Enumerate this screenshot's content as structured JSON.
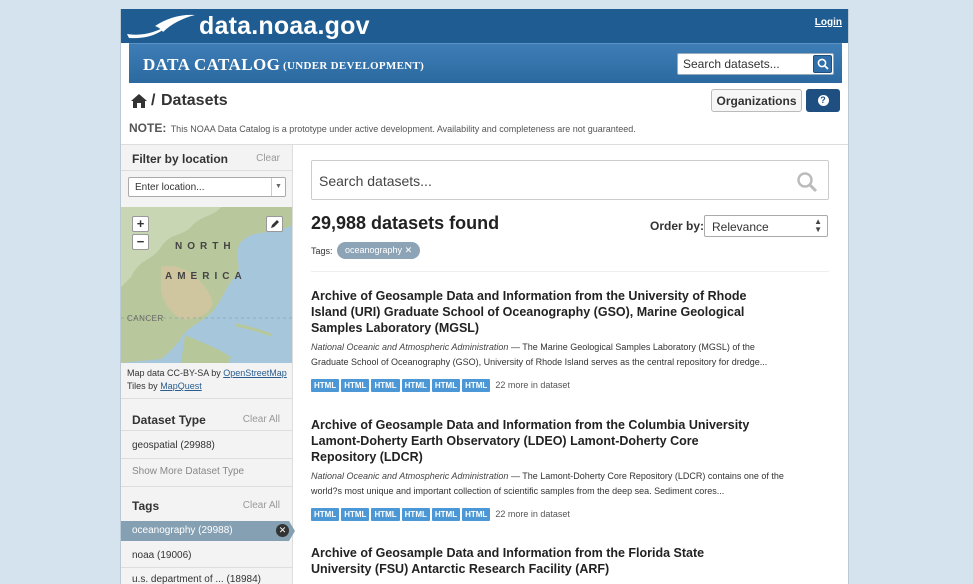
{
  "header": {
    "logo_text": "data.noaa.gov",
    "login_label": "Login",
    "catalog_title": "DATA CATALOG",
    "catalog_subtitle": "(UNDER DEVELOPMENT)",
    "search_placeholder": "Search datasets..."
  },
  "breadcrumb": {
    "separator": "/",
    "current": "Datasets"
  },
  "buttons": {
    "organizations": "Organizations",
    "help_icon": "?"
  },
  "note": {
    "label": "NOTE:",
    "text": "This NOAA Data Catalog is a prototype under active development. Availability and completeness are not guaranteed."
  },
  "sidebar": {
    "location": {
      "title": "Filter by location",
      "clear": "Clear",
      "placeholder": "Enter location...",
      "map_labels": [
        "NORTH",
        "AMERICA",
        "CANCER"
      ],
      "attribution_line1_prefix": "Map data CC-BY-SA by ",
      "attribution_line1_link": "OpenStreetMap",
      "attribution_line2_prefix": "Tiles by ",
      "attribution_line2_link": "MapQuest"
    },
    "dataset_type": {
      "title": "Dataset Type",
      "clear": "Clear All",
      "items": [
        "geospatial (29988)"
      ],
      "show_more": "Show More Dataset Type"
    },
    "tags": {
      "title": "Tags",
      "clear": "Clear All",
      "active": "oceanography (29988)",
      "items": [
        "noaa (19006)",
        "u.s. department of ... (18984)"
      ]
    }
  },
  "main": {
    "search_placeholder": "Search datasets...",
    "count": "29,988 datasets found",
    "order_label": "Order by:",
    "order_value": "Relevance",
    "tags_label": "Tags:",
    "active_tag": "oceanography",
    "results": [
      {
        "title": "Archive of Geosample Data and Information from the University of Rhode Island (URI) Graduate School of Oceanography (GSO), Marine Geological Samples Laboratory (MGSL)",
        "publisher": "National Oceanic and Atmospheric Administration",
        "description": " — The Marine Geological Samples Laboratory (MGSL) of the Graduate School of Oceanography (GSO), University of Rhode Island serves as the central repository for dredge...",
        "formats": [
          "HTML",
          "HTML",
          "HTML",
          "HTML",
          "HTML",
          "HTML"
        ],
        "more": "22 more in dataset"
      },
      {
        "title": "Archive of Geosample Data and Information from the Columbia University Lamont-Doherty Earth Observatory (LDEO) Lamont-Doherty Core Repository (LDCR)",
        "publisher": "National Oceanic and Atmospheric Administration",
        "description": " — The Lamont-Doherty Core Repository (LDCR) contains one of the world?s most unique and important collection of scientific samples from the deep sea. Sediment cores...",
        "formats": [
          "HTML",
          "HTML",
          "HTML",
          "HTML",
          "HTML",
          "HTML"
        ],
        "more": "22 more in dataset"
      },
      {
        "title": "Archive of Geosample Data and Information from the Florida State University (FSU) Antarctic Research Facility (ARF)"
      }
    ]
  },
  "colors": {
    "page_bg": "#d5e3ef",
    "header_blue": "#1f5c91",
    "catalog_bar": "#2f6ea8",
    "format_badge": "#4c98d6",
    "active_tag": "#86a0b3"
  }
}
